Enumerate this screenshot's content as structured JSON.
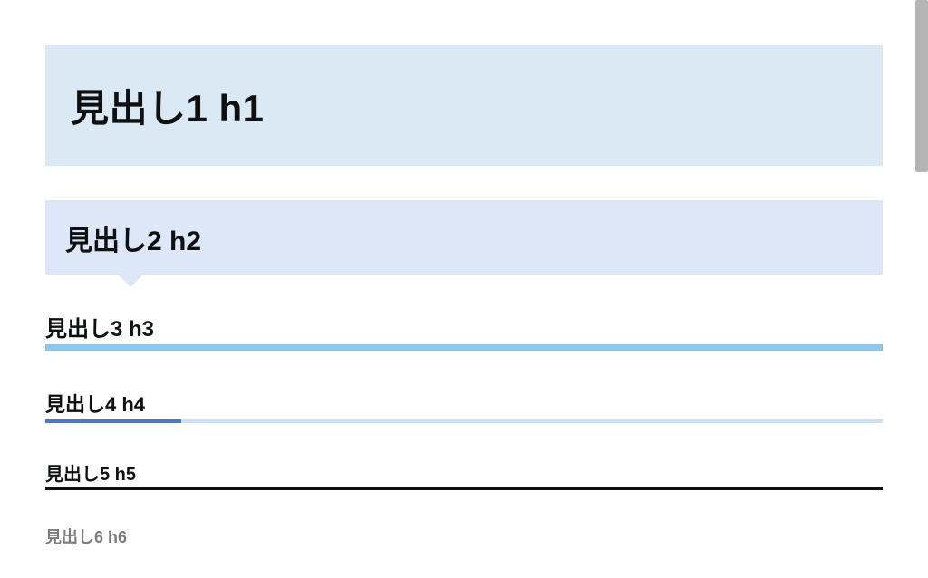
{
  "headings": {
    "h1": "見出し1 h1",
    "h2": "見出し2 h2",
    "h3": "見出し3 h3",
    "h4": "見出し4 h4",
    "h5": "見出し5 h5",
    "h6": "見出し6 h6"
  }
}
